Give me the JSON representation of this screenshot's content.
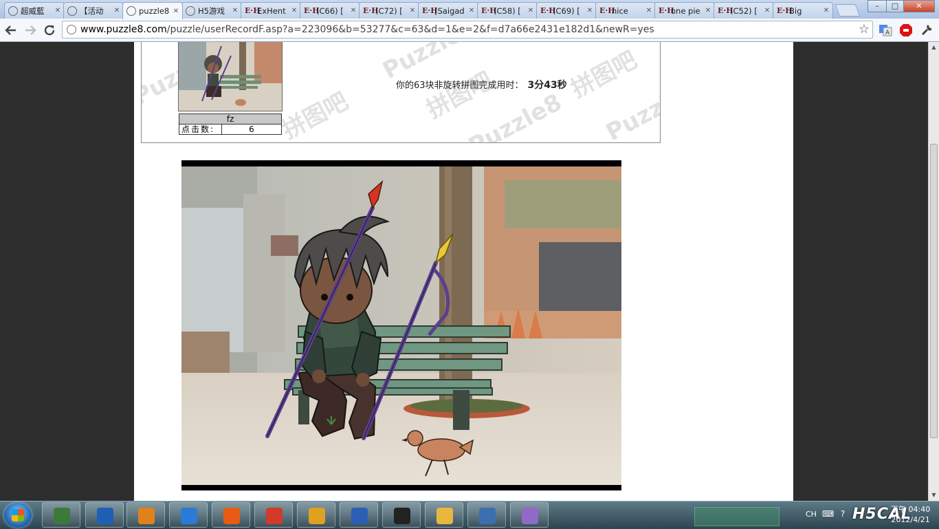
{
  "browser": {
    "tabs": [
      {
        "title": "超威藍",
        "icon": "globe"
      },
      {
        "title": "【活动",
        "icon": "globe"
      },
      {
        "title": "puzzle8",
        "icon": "globe",
        "active": true
      },
      {
        "title": "H5游戏",
        "icon": "globe"
      },
      {
        "title": "ExHent",
        "icon": "eh"
      },
      {
        "title": "(C66) [",
        "icon": "eh"
      },
      {
        "title": "(C72) [",
        "icon": "eh"
      },
      {
        "title": "[Saigad",
        "icon": "eh"
      },
      {
        "title": "(C58) [",
        "icon": "eh"
      },
      {
        "title": "(C69) [",
        "icon": "eh"
      },
      {
        "title": "nice",
        "icon": "eh"
      },
      {
        "title": "one pie",
        "icon": "eh"
      },
      {
        "title": "(C52) [",
        "icon": "eh"
      },
      {
        "title": "Big",
        "icon": "eh"
      }
    ],
    "eh_glyph": "E·H",
    "url_host": "www.puzzle8.com",
    "url_path": "/puzzle/userRecordF.asp?a=223096&b=53277&c=63&d=1&e=2&f=d7a66e2431e182d1&newR=yes",
    "window_buttons": {
      "minimize": "–",
      "maximize": "□",
      "close": "✕"
    }
  },
  "page": {
    "user": {
      "name": "fz",
      "clicks_label": "点击数:",
      "clicks": "6"
    },
    "result": {
      "text": "你的63块非旋转拼图完成用时：",
      "time": "3分43秒"
    },
    "watermarks": [
      "Puzzle8",
      "拼图吧"
    ]
  },
  "taskbar": {
    "apps": [
      "taskmgr",
      "puzzle-app",
      "media",
      "ie",
      "firefox",
      "chrome",
      "player",
      "word",
      "qq",
      "explorer",
      "wordpad",
      "paint"
    ],
    "language": "CH",
    "clock_time": "下午 04:40",
    "clock_date": "2012/4/21",
    "brand": "H5CAL"
  },
  "colors": {
    "eh_red": "#6b1b1b",
    "page_bg": "#2d2d2d",
    "chrome_blue": "#a9c1e2"
  }
}
